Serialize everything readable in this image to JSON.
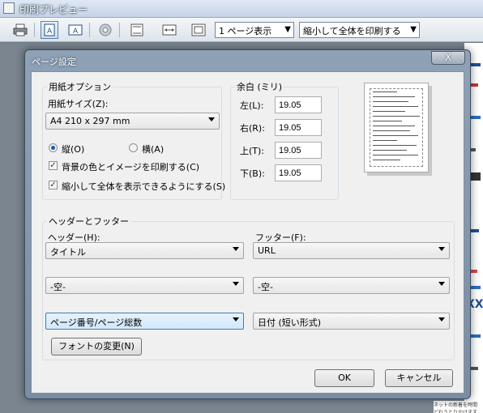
{
  "window": {
    "title": "印刷プレビュー"
  },
  "toolbar": {
    "page_view": "1 ページ表示",
    "shrink_option": "縮小して全体を印刷する"
  },
  "dialog": {
    "title": "ページ設定",
    "close_label": "X",
    "paper_group": "用紙オプション",
    "paper_size_label": "用紙サイズ(Z):",
    "paper_size_value": "A4 210 x 297 mm",
    "portrait_label": "縦(O)",
    "landscape_label": "横(A)",
    "orientation_selected": "portrait",
    "print_bg_label": "背景の色とイメージを印刷する(C)",
    "print_bg_checked": true,
    "shrink_label": "縮小して全体を表示できるようにする(S)",
    "shrink_checked": true,
    "margins_group": "余白 (ミリ)",
    "margin_left_label": "左(L):",
    "margin_left": "19.05",
    "margin_right_label": "右(R):",
    "margin_right": "19.05",
    "margin_top_label": "上(T):",
    "margin_top": "19.05",
    "margin_bottom_label": "下(B):",
    "margin_bottom": "19.05",
    "hf_group": "ヘッダーとフッター",
    "header_label": "ヘッダー(H):",
    "footer_label": "フッター(F):",
    "header1": "タイトル",
    "header2": "-空-",
    "header3": "ページ番号/ページ総数",
    "footer1": "URL",
    "footer2": "-空-",
    "footer3": "日付 (短い形式)",
    "font_button": "フォントの変更(N)",
    "ok_button": "OK",
    "cancel_button": "キャンセル"
  },
  "background": {
    "right_strip_text": "XX",
    "bottom_text": "ネットの新着を時間 どれうとりかけます"
  }
}
